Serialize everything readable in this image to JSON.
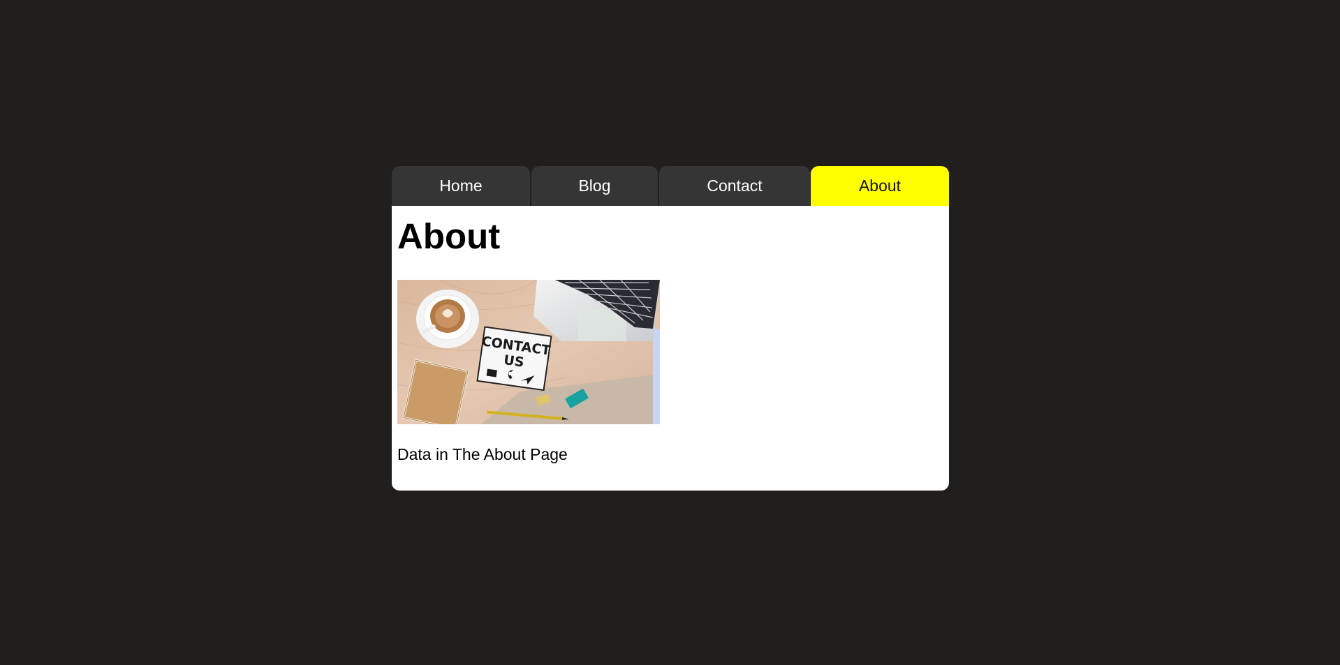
{
  "tabs": [
    {
      "label": "Home",
      "active": false
    },
    {
      "label": "Blog",
      "active": false
    },
    {
      "label": "Contact",
      "active": false
    },
    {
      "label": "About",
      "active": true
    }
  ],
  "content": {
    "heading": "About",
    "photo": {
      "lightbox_line1": "CONTACT",
      "lightbox_line2": "US"
    },
    "body_text": "Data in The About Page"
  },
  "colors": {
    "background": "#201f1d",
    "tab_inactive": "#353535",
    "tab_active": "#ffff00",
    "panel": "#ffffff"
  }
}
